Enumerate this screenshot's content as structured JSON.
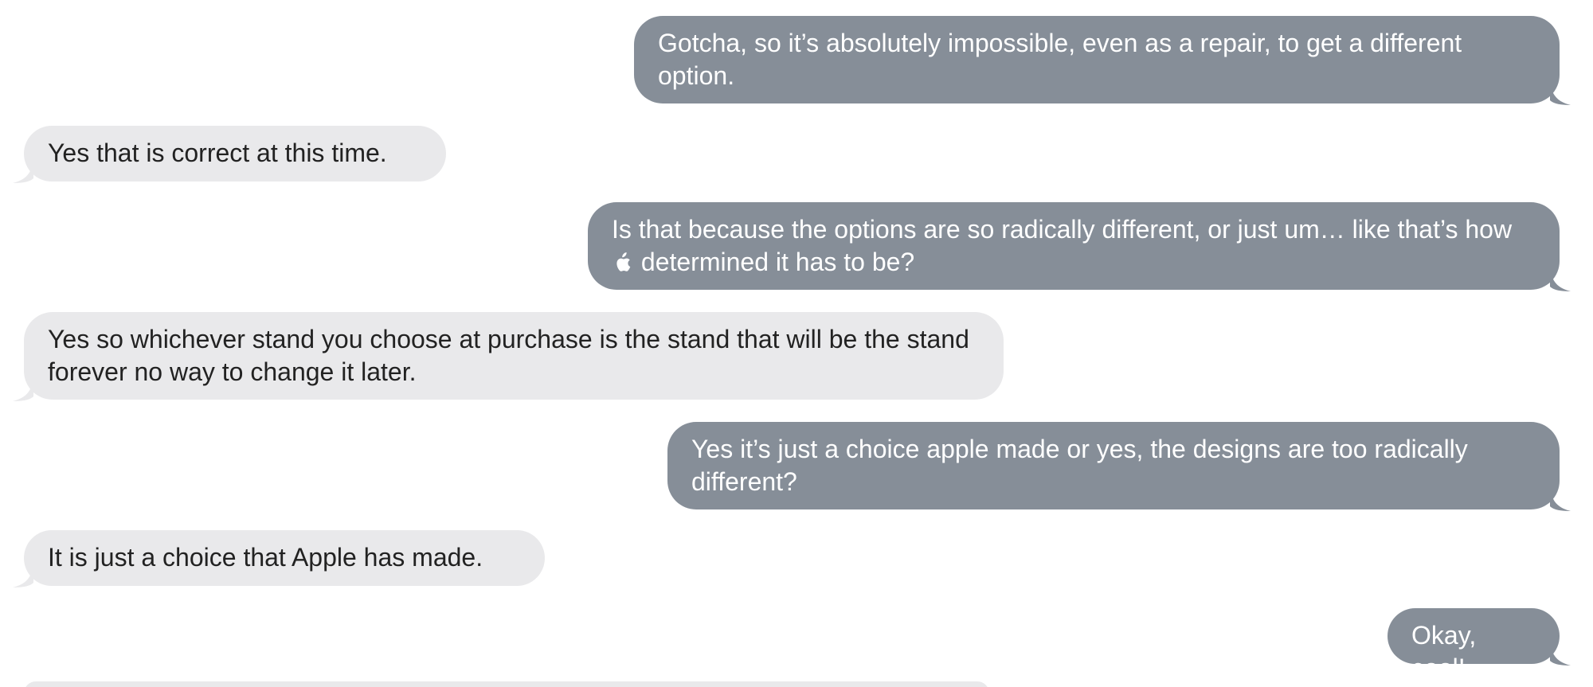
{
  "conversation": {
    "messages": [
      {
        "side": "sent",
        "text": "Gotcha, so it’s absolutely impossible, even as a repair, to get a different option."
      },
      {
        "side": "received",
        "text": "Yes that is correct at this time."
      },
      {
        "side": "sent",
        "text_before_icon": "Is that because the options are so radically different, or just um… like that’s how",
        "icon": "apple-logo-icon",
        "text_after_icon": "determined it has to be?"
      },
      {
        "side": "received",
        "text": "Yes so whichever stand you choose at purchase is the stand that will be the stand forever no way to change it later."
      },
      {
        "side": "sent",
        "text": "Yes it’s just a choice apple made or yes, the designs are too radically different?"
      },
      {
        "side": "received",
        "text": "It is just a choice that Apple has made."
      },
      {
        "side": "sent",
        "text": "Okay, cool!"
      }
    ]
  },
  "colors": {
    "sent_bubble": "#868e98",
    "received_bubble": "#e9e9eb",
    "sent_text": "#ffffff",
    "received_text": "#222222",
    "background": "#ffffff"
  }
}
